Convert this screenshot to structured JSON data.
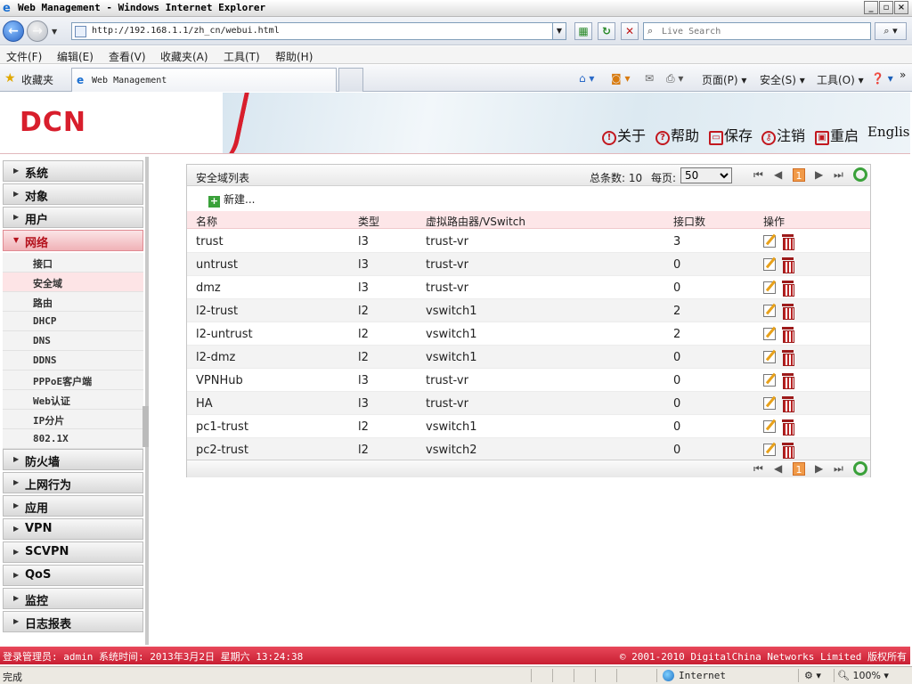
{
  "browser": {
    "window_title": "Web Management - Windows Internet Explorer",
    "url": "http://192.168.1.1/zh_cn/webui.html",
    "search_placeholder": "Live Search",
    "menu": [
      "文件(F)",
      "编辑(E)",
      "查看(V)",
      "收藏夹(A)",
      "工具(T)",
      "帮助(H)"
    ],
    "favorites_label": "收藏夹",
    "tab_title": "Web Management",
    "commands": {
      "page": "页面(P)",
      "safety": "安全(S)",
      "tools": "工具(O)"
    },
    "status": "完成",
    "zone": "Internet",
    "zoom": "100%"
  },
  "header": {
    "logo": "DCN",
    "about": "关于",
    "help": "帮助",
    "save": "保存",
    "logout": "注销",
    "restart": "重启",
    "language": "English"
  },
  "sidebar": {
    "items": [
      {
        "label": "系统"
      },
      {
        "label": "对象"
      },
      {
        "label": "用户"
      },
      {
        "label": "网络"
      },
      {
        "label": "防火墙"
      },
      {
        "label": "上网行为"
      },
      {
        "label": "应用"
      },
      {
        "label": "VPN"
      },
      {
        "label": "SCVPN"
      },
      {
        "label": "QoS"
      },
      {
        "label": "监控"
      },
      {
        "label": "日志报表"
      }
    ],
    "network_sub": [
      "接口",
      "安全域",
      "路由",
      "DHCP",
      "DNS",
      "DDNS",
      "PPPoE客户端",
      "Web认证",
      "IP分片",
      "802.1X"
    ]
  },
  "panel": {
    "title": "安全域列表",
    "total": "总条数: 10",
    "per_page_label": "每页:",
    "per_page_value": "50",
    "current_page": "1",
    "new_label": "新建...",
    "columns": [
      "名称",
      "类型",
      "虚拟路由器/VSwitch",
      "接口数",
      "操作"
    ],
    "rows": [
      {
        "name": "trust",
        "type": "l3",
        "vr": "trust-vr",
        "count": "3"
      },
      {
        "name": "untrust",
        "type": "l3",
        "vr": "trust-vr",
        "count": "0"
      },
      {
        "name": "dmz",
        "type": "l3",
        "vr": "trust-vr",
        "count": "0"
      },
      {
        "name": "l2-trust",
        "type": "l2",
        "vr": "vswitch1",
        "count": "2"
      },
      {
        "name": "l2-untrust",
        "type": "l2",
        "vr": "vswitch1",
        "count": "2"
      },
      {
        "name": "l2-dmz",
        "type": "l2",
        "vr": "vswitch1",
        "count": "0"
      },
      {
        "name": "VPNHub",
        "type": "l3",
        "vr": "trust-vr",
        "count": "0"
      },
      {
        "name": "HA",
        "type": "l3",
        "vr": "trust-vr",
        "count": "0"
      },
      {
        "name": "pc1-trust",
        "type": "l2",
        "vr": "vswitch1",
        "count": "0"
      },
      {
        "name": "pc2-trust",
        "type": "l2",
        "vr": "vswitch2",
        "count": "0"
      }
    ]
  },
  "footer": {
    "left": "登录管理员: admin 系统时间: 2013年3月2日 星期六 13:24:38",
    "right": "© 2001-2010 DigitalChina Networks Limited 版权所有"
  },
  "colors": {
    "brand": "#d81e2c",
    "active_nav": "#f0b2b7",
    "header_row": "#fde6e8"
  }
}
